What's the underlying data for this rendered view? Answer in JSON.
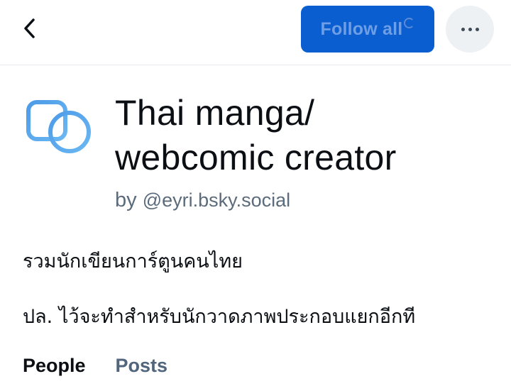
{
  "header": {
    "follow_all_label": "Follow all"
  },
  "feed": {
    "title_line1": "Thai manga/",
    "title_line2": "webcomic creator",
    "by_label": "by",
    "creator_handle": "@eyri.bsky.social",
    "description_line1": "รวมนักเขียนการ์ตูนคนไทย",
    "description_line2": "ปล. ไว้จะทำสำหรับนักวาดภาพประกอบแยกอีกที"
  },
  "tabs": [
    {
      "label": "People",
      "active": true
    },
    {
      "label": "Posts",
      "active": false
    }
  ],
  "colors": {
    "primary": "#0a5ecf",
    "icon_blue": "#4aa0ea",
    "muted_text": "#5b6b7b"
  },
  "icons": {
    "back": "chevron-left-icon",
    "more": "ellipsis-icon",
    "feed": "list-feed-icon",
    "loading": "spinner-icon"
  }
}
